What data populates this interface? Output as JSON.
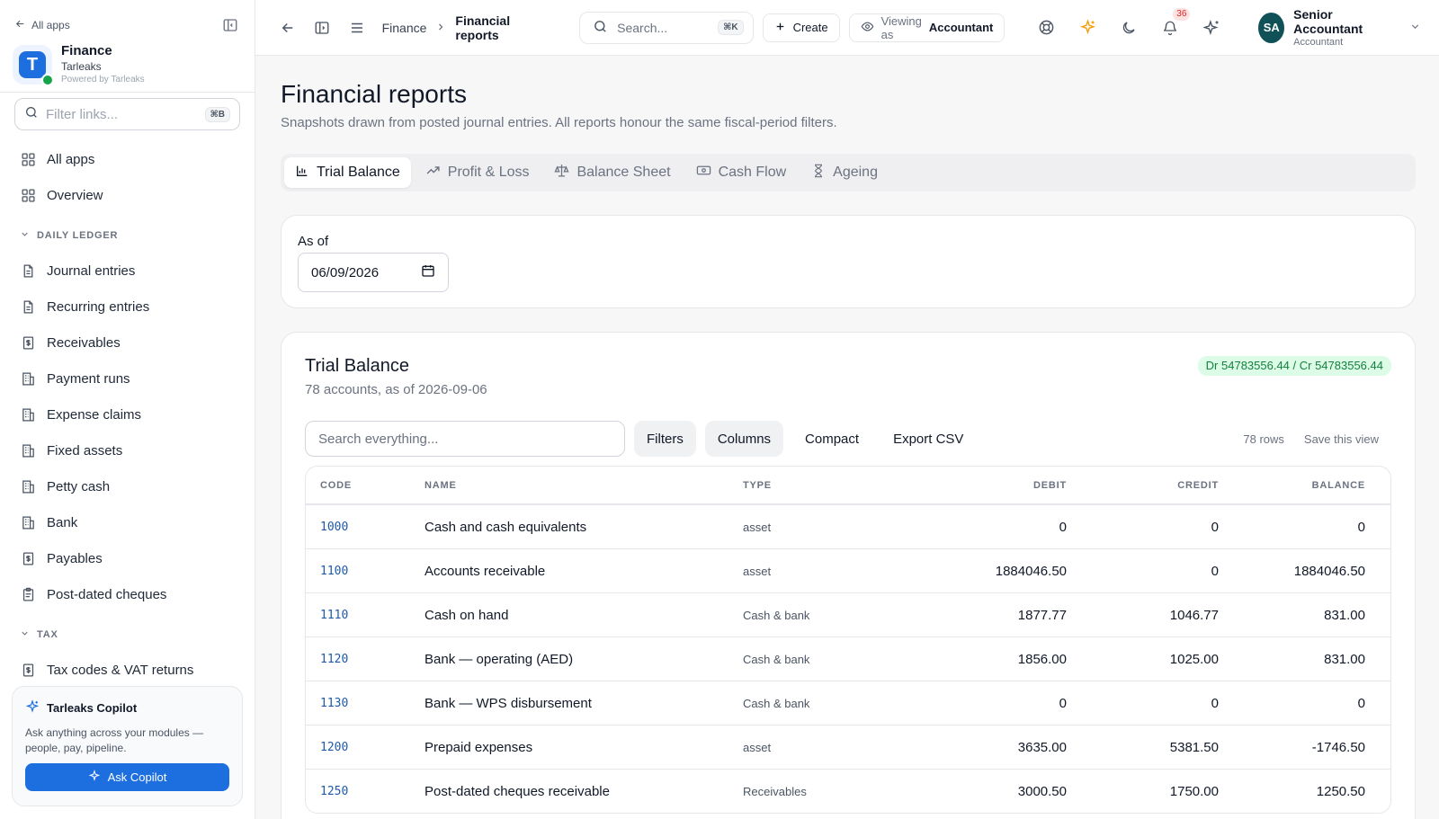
{
  "sidebar": {
    "back_label": "All apps",
    "brand": {
      "name": "Finance",
      "org": "Tarleaks",
      "powered": "Powered by Tarleaks",
      "logo_letter": "T"
    },
    "filter": {
      "placeholder": "Filter links...",
      "shortcut": "⌘B"
    },
    "top_items": [
      {
        "label": "All apps",
        "icon": "grid-icon"
      },
      {
        "label": "Overview",
        "icon": "grid-icon"
      }
    ],
    "sections": [
      {
        "title": "DAILY LEDGER",
        "items": [
          {
            "label": "Journal entries",
            "icon": "document-icon"
          },
          {
            "label": "Recurring entries",
            "icon": "document-icon"
          },
          {
            "label": "Receivables",
            "icon": "invoice-icon"
          },
          {
            "label": "Payment runs",
            "icon": "building-icon"
          },
          {
            "label": "Expense claims",
            "icon": "building-icon"
          },
          {
            "label": "Fixed assets",
            "icon": "building-icon"
          },
          {
            "label": "Petty cash",
            "icon": "building-icon"
          },
          {
            "label": "Bank",
            "icon": "building-icon"
          },
          {
            "label": "Payables",
            "icon": "invoice-icon"
          },
          {
            "label": "Post-dated cheques",
            "icon": "clipboard-icon"
          }
        ]
      },
      {
        "title": "TAX",
        "items": [
          {
            "label": "Tax codes & VAT returns",
            "icon": "invoice-icon"
          }
        ]
      }
    ],
    "copilot": {
      "title": "Tarleaks Copilot",
      "description": "Ask anything across your modules — people, pay, pipeline.",
      "button": "Ask Copilot"
    }
  },
  "topbar": {
    "breadcrumb": [
      "Finance",
      "Financial reports"
    ],
    "search": {
      "placeholder": "Search...",
      "shortcut": "⌘K"
    },
    "create_label": "Create",
    "viewing": {
      "label": "Viewing as",
      "value": "Accountant"
    },
    "notifications_count": "36",
    "user": {
      "initials": "SA",
      "name": "Senior Accountant",
      "role": "Accountant"
    }
  },
  "page": {
    "title": "Financial reports",
    "subtitle": "Snapshots drawn from posted journal entries. All reports honour the same fiscal-period filters.",
    "tabs": [
      {
        "label": "Trial Balance",
        "icon": "bar-chart-icon",
        "active": true
      },
      {
        "label": "Profit & Loss",
        "icon": "trending-up-icon",
        "active": false
      },
      {
        "label": "Balance Sheet",
        "icon": "scale-icon",
        "active": false
      },
      {
        "label": "Cash Flow",
        "icon": "banknote-icon",
        "active": false
      },
      {
        "label": "Ageing",
        "icon": "hourglass-icon",
        "active": false
      }
    ],
    "as_of": {
      "label": "As of",
      "value": "06/09/2026"
    }
  },
  "trial_balance": {
    "title": "Trial Balance",
    "subtitle": "78 accounts, as of 2026-09-06",
    "balance_pill": "Dr 54783556.44 / Cr 54783556.44",
    "search_placeholder": "Search everything...",
    "buttons": {
      "filters": "Filters",
      "columns": "Columns",
      "compact": "Compact",
      "export": "Export CSV"
    },
    "rows_count": "78 rows",
    "save_view": "Save this view",
    "columns": [
      "CODE",
      "NAME",
      "TYPE",
      "DEBIT",
      "CREDIT",
      "BALANCE"
    ],
    "rows": [
      {
        "code": "1000",
        "name": "Cash and cash equivalents",
        "type": "asset",
        "debit": "0",
        "credit": "0",
        "balance": "0"
      },
      {
        "code": "1100",
        "name": "Accounts receivable",
        "type": "asset",
        "debit": "1884046.50",
        "credit": "0",
        "balance": "1884046.50"
      },
      {
        "code": "1110",
        "name": "Cash on hand",
        "type": "Cash & bank",
        "debit": "1877.77",
        "credit": "1046.77",
        "balance": "831.00"
      },
      {
        "code": "1120",
        "name": "Bank — operating (AED)",
        "type": "Cash & bank",
        "debit": "1856.00",
        "credit": "1025.00",
        "balance": "831.00"
      },
      {
        "code": "1130",
        "name": "Bank — WPS disbursement",
        "type": "Cash & bank",
        "debit": "0",
        "credit": "0",
        "balance": "0"
      },
      {
        "code": "1200",
        "name": "Prepaid expenses",
        "type": "asset",
        "debit": "3635.00",
        "credit": "5381.50",
        "balance": "-1746.50"
      },
      {
        "code": "1250",
        "name": "Post-dated cheques receivable",
        "type": "Receivables",
        "debit": "3000.50",
        "credit": "1750.00",
        "balance": "1250.50"
      }
    ]
  },
  "colors": {
    "accent": "#1d6fe0",
    "success_bg": "#dcfce7",
    "success_text": "#15803d",
    "avatar": "#0f5156"
  }
}
